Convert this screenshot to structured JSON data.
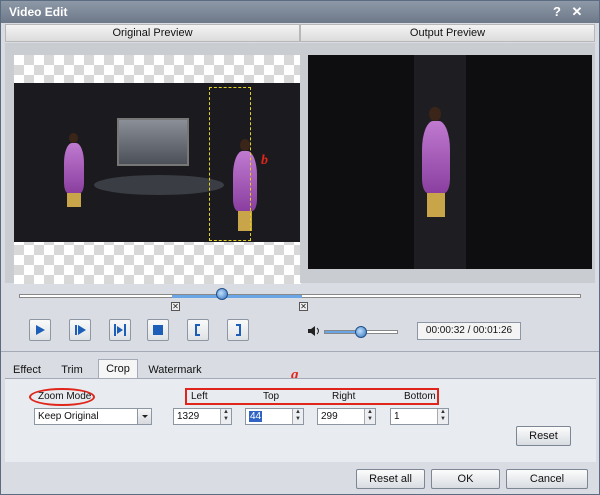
{
  "window": {
    "title": "Video Edit",
    "help_label": "?",
    "close_label": "✕"
  },
  "preview": {
    "original_label": "Original Preview",
    "output_label": "Output Preview"
  },
  "annotations": {
    "a": "a",
    "b": "b"
  },
  "playback": {
    "time": "00:00:32 / 00:01:26",
    "volume_level": 0.48,
    "trim_start_marker": "✕",
    "trim_end_marker": "✕"
  },
  "tabs": [
    {
      "label": "Effect"
    },
    {
      "label": "Trim"
    },
    {
      "label": "Crop"
    },
    {
      "label": "Watermark"
    }
  ],
  "active_tab": "Crop",
  "crop": {
    "zoom_mode_label": "Zoom Mode",
    "zoom_mode_value": "Keep Original",
    "left_label": "Left",
    "top_label": "Top",
    "right_label": "Right",
    "bottom_label": "Bottom",
    "left_value": "1329",
    "top_value": "44",
    "right_value": "299",
    "bottom_value": "1",
    "reset_label": "Reset"
  },
  "footer": {
    "reset_all_label": "Reset all",
    "ok_label": "OK",
    "cancel_label": "Cancel"
  },
  "colors": {
    "annotation_red": "#e0261b",
    "crop_dash": "#e2d21b",
    "accent_blue": "#6aa6e6"
  },
  "icons": [
    "play-icon",
    "step-forward-icon",
    "play-selection-icon",
    "stop-icon",
    "mark-in-icon",
    "mark-out-icon",
    "speaker-icon",
    "dropdown-arrow-icon"
  ]
}
